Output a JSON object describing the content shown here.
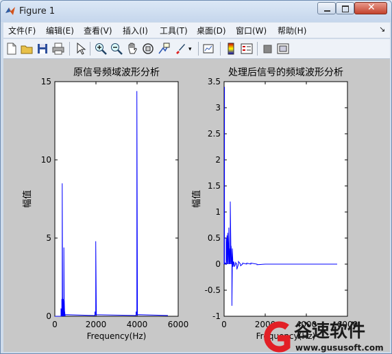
{
  "window": {
    "title": "Figure 1"
  },
  "menu": [
    "文件(F)",
    "编辑(E)",
    "查看(V)",
    "插入(I)",
    "工具(T)",
    "桌面(D)",
    "窗口(W)",
    "帮助(H)"
  ],
  "menu_arrow": "↘",
  "toolbar_icons": [
    "new-figure-icon",
    "open-file-icon",
    "save-icon",
    "print-icon",
    "arrow-cursor-icon",
    "zoom-in-icon",
    "zoom-out-icon",
    "pan-hand-icon",
    "rotate-3d-icon",
    "data-cursor-icon",
    "brush-icon",
    "link-plot-icon",
    "colorbar-icon",
    "legend-icon",
    "hide-plot-tools-icon",
    "show-plot-tools-icon"
  ],
  "colors": {
    "line": "#0000ff",
    "figure_bg": "#c8c8c8",
    "axes_bg": "#ffffff",
    "watermark_red": "#e21f26"
  },
  "watermark": {
    "brand": "谷速软件",
    "url": "www.gususoft.com"
  },
  "chart_data": [
    {
      "type": "line",
      "title": "原信号频域波形分析",
      "xlabel": "Frequency(Hz)",
      "ylabel": "幅值",
      "xlim": [
        0,
        6000
      ],
      "ylim": [
        0,
        15
      ],
      "xticks": [
        0,
        2000,
        4000,
        6000
      ],
      "yticks": [
        0,
        5,
        10,
        15
      ],
      "grid": false,
      "series": [
        {
          "x": [
            0,
            300,
            300,
            340,
            340,
            360,
            360,
            380,
            380,
            400,
            400,
            420,
            420,
            440,
            440,
            460,
            460,
            480,
            480,
            500,
            500,
            1950,
            1950,
            1990,
            1990,
            2020,
            2020,
            3950,
            3950,
            3990,
            3990,
            4020,
            4020,
            5500
          ],
          "y": [
            0,
            0,
            0.5,
            0,
            1.1,
            0,
            8.5,
            0,
            1.2,
            0,
            0.8,
            0,
            1.1,
            0,
            4.4,
            0,
            1.0,
            0,
            0.3,
            0,
            0.1,
            0.05,
            0.3,
            0.1,
            4.8,
            0.05,
            0.1,
            0.05,
            0.3,
            0.1,
            14.4,
            0.05,
            0.1,
            0.05
          ]
        }
      ]
    },
    {
      "type": "line",
      "title": "处理后信号的频域波形分析",
      "xlabel": "Frequency(Hz)",
      "ylabel": "幅值",
      "xlim": [
        0,
        6000
      ],
      "ylim": [
        -1,
        3.5
      ],
      "xticks": [
        0,
        2000,
        4000,
        6000
      ],
      "yticks": [
        -1,
        -0.5,
        0,
        0.5,
        1,
        1.5,
        2,
        2.5,
        3,
        3.5
      ],
      "grid": false,
      "series": [
        {
          "x": [
            0,
            20,
            20,
            40,
            60,
            100,
            100,
            140,
            140,
            180,
            180,
            230,
            230,
            260,
            260,
            300,
            300,
            340,
            340,
            380,
            380,
            400,
            400,
            430,
            430,
            460,
            460,
            500,
            500,
            560,
            560,
            620,
            620,
            700,
            700,
            800,
            800,
            900,
            900,
            1100,
            1100,
            1300,
            1300,
            1600,
            1600,
            2000,
            2500,
            3000,
            3500,
            4000,
            4500,
            5000,
            5500
          ],
          "y": [
            0,
            3.4,
            0,
            0,
            0.02,
            0,
            0.5,
            0,
            0.55,
            0,
            0.6,
            0,
            0.7,
            0,
            0.3,
            0,
            1.2,
            0,
            0.35,
            0,
            -0.8,
            0,
            0.3,
            0,
            -0.05,
            0,
            0.05,
            0,
            -0.05,
            0,
            0.03,
            0,
            -0.1,
            0,
            0.05,
            0,
            -0.03,
            0,
            0.02,
            0,
            0.02,
            0,
            0.02,
            0,
            -0.01,
            0,
            0,
            0,
            0,
            0,
            0,
            0,
            0
          ]
        }
      ]
    }
  ]
}
